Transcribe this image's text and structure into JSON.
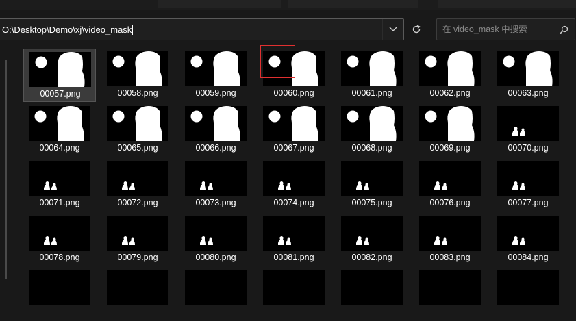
{
  "address_bar": {
    "path": "O:\\Desktop\\Demo\\xj\\video_mask"
  },
  "search": {
    "placeholder": "在 video_mask 中搜索"
  },
  "icons": {
    "address_dropdown": "chevron-down-icon",
    "refresh": "refresh-icon",
    "search": "search-icon",
    "thumbnail": "image-thumbnail-icon"
  },
  "colors": {
    "background": "#191919",
    "selection": "#3b3b3b",
    "highlight_box": "#e03030"
  },
  "files": [
    {
      "name": "00057.png",
      "thumb": "large",
      "selected": true
    },
    {
      "name": "00058.png",
      "thumb": "large"
    },
    {
      "name": "00059.png",
      "thumb": "large"
    },
    {
      "name": "00060.png",
      "thumb": "large",
      "highlighted": true
    },
    {
      "name": "00061.png",
      "thumb": "large"
    },
    {
      "name": "00062.png",
      "thumb": "large"
    },
    {
      "name": "00063.png",
      "thumb": "large"
    },
    {
      "name": "00064.png",
      "thumb": "large"
    },
    {
      "name": "00065.png",
      "thumb": "large"
    },
    {
      "name": "00066.png",
      "thumb": "large"
    },
    {
      "name": "00067.png",
      "thumb": "large"
    },
    {
      "name": "00068.png",
      "thumb": "large"
    },
    {
      "name": "00069.png",
      "thumb": "large"
    },
    {
      "name": "00070.png",
      "thumb": "small"
    },
    {
      "name": "00071.png",
      "thumb": "small"
    },
    {
      "name": "00072.png",
      "thumb": "small"
    },
    {
      "name": "00073.png",
      "thumb": "small"
    },
    {
      "name": "00074.png",
      "thumb": "small"
    },
    {
      "name": "00075.png",
      "thumb": "small"
    },
    {
      "name": "00076.png",
      "thumb": "small"
    },
    {
      "name": "00077.png",
      "thumb": "small"
    },
    {
      "name": "00078.png",
      "thumb": "small"
    },
    {
      "name": "00079.png",
      "thumb": "small"
    },
    {
      "name": "00080.png",
      "thumb": "small"
    },
    {
      "name": "00081.png",
      "thumb": "small"
    },
    {
      "name": "00082.png",
      "thumb": "small"
    },
    {
      "name": "00083.png",
      "thumb": "small"
    },
    {
      "name": "00084.png",
      "thumb": "small"
    },
    {
      "name": "",
      "thumb": "blank"
    },
    {
      "name": "",
      "thumb": "blank"
    },
    {
      "name": "",
      "thumb": "blank"
    },
    {
      "name": "",
      "thumb": "blank"
    },
    {
      "name": "",
      "thumb": "blank"
    },
    {
      "name": "",
      "thumb": "blank"
    },
    {
      "name": "",
      "thumb": "blank"
    }
  ]
}
